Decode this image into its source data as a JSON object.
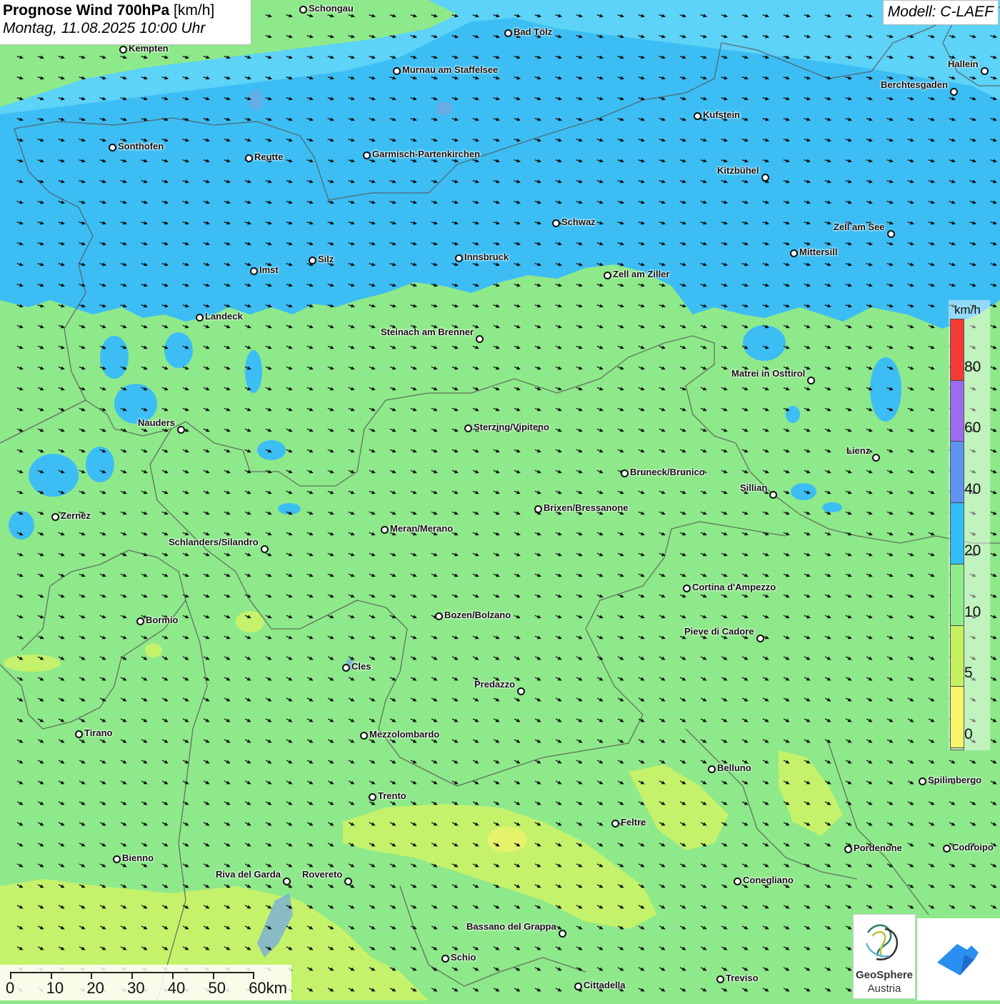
{
  "title": {
    "main": "Prognose Wind 700hPa",
    "unit": "[km/h]",
    "date": "Montag, 11.08.2025 10:00 Uhr"
  },
  "model": "Modell: C-LAEF",
  "legend": {
    "unit": "km/h",
    "labels": [
      "80",
      "60",
      "40",
      "20",
      "10",
      "5",
      "0"
    ],
    "colors": [
      "#f43a34",
      "#9b6cf0",
      "#5e93ef",
      "#31bdf5",
      "#8fec8c",
      "#c4f25e",
      "#f8f46a"
    ]
  },
  "scale_bar": {
    "labels": [
      "0",
      "10",
      "20",
      "30",
      "40",
      "50",
      "60km"
    ]
  },
  "cities": [
    {
      "name": "Schongau"
    },
    {
      "name": "Bad Tölz"
    },
    {
      "name": "Kempten"
    },
    {
      "name": "Murnau am Staffelsee"
    },
    {
      "name": "Hallein"
    },
    {
      "name": "Berchtesgaden"
    },
    {
      "name": "Kufstein"
    },
    {
      "name": "Sonthofen"
    },
    {
      "name": "Reutte"
    },
    {
      "name": "Garmisch-Partenkirchen"
    },
    {
      "name": "Kitzbühel"
    },
    {
      "name": "Schwaz"
    },
    {
      "name": "Zell am See"
    },
    {
      "name": "Mittersill"
    },
    {
      "name": "Innsbruck"
    },
    {
      "name": "Silz"
    },
    {
      "name": "Imst"
    },
    {
      "name": "Zell am Ziller"
    },
    {
      "name": "Landeck"
    },
    {
      "name": "Steinach am Brenner"
    },
    {
      "name": "Matrei in Osttirol"
    },
    {
      "name": "Nauders"
    },
    {
      "name": "Sterzing/Vipiteno"
    },
    {
      "name": "Lienz"
    },
    {
      "name": "Bruneck/Brunico"
    },
    {
      "name": "Sillian"
    },
    {
      "name": "Zernez"
    },
    {
      "name": "Brixen/Bressanone"
    },
    {
      "name": "Meran/Merano"
    },
    {
      "name": "Schlanders/Silandro"
    },
    {
      "name": "Cortina d'Ampezzo"
    },
    {
      "name": "Bormio"
    },
    {
      "name": "Bozen/Bolzano"
    },
    {
      "name": "Pieve di Cadore"
    },
    {
      "name": "Cles"
    },
    {
      "name": "Predazzo"
    },
    {
      "name": "Tirano"
    },
    {
      "name": "Mezzolombardo"
    },
    {
      "name": "Belluno"
    },
    {
      "name": "Spilimbergo"
    },
    {
      "name": "Trento"
    },
    {
      "name": "Feltre"
    },
    {
      "name": "Bienno"
    },
    {
      "name": "Pordenone"
    },
    {
      "name": "Codroipo"
    },
    {
      "name": "Riva del Garda"
    },
    {
      "name": "Rovereto"
    },
    {
      "name": "Conegliano"
    },
    {
      "name": "Bassano del Grappa"
    },
    {
      "name": "Schio"
    },
    {
      "name": "Cittadella"
    },
    {
      "name": "Treviso"
    }
  ],
  "logos": {
    "geosphere_line1": "GeoSphere",
    "geosphere_line2": "Austria"
  }
}
